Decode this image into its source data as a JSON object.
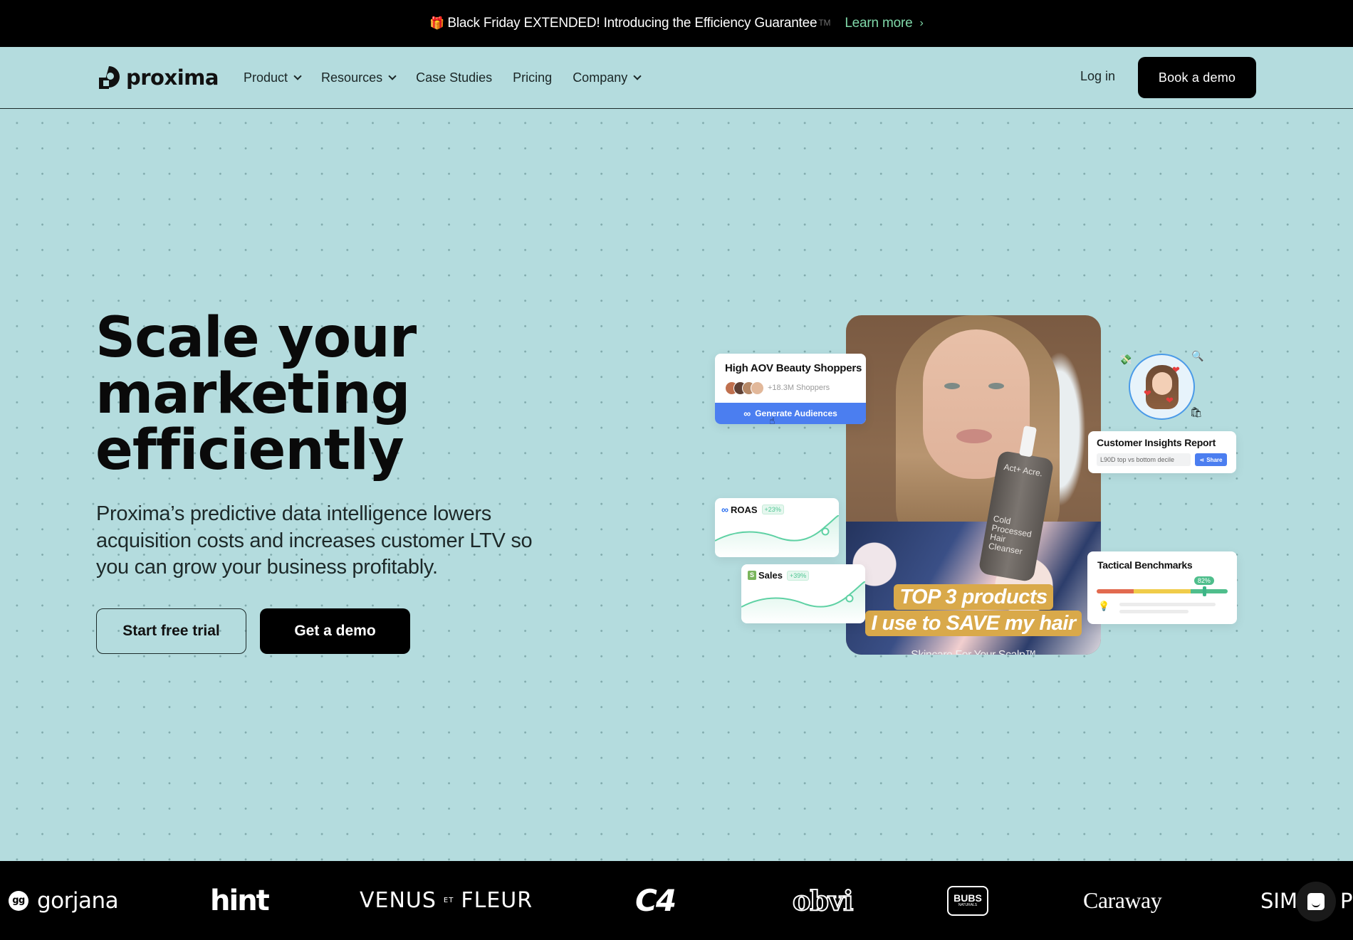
{
  "announcement": {
    "icon": "gift-icon",
    "text": "Black Friday EXTENDED! Introducing the Efficiency Guarantee",
    "trademark": "TM",
    "link_label": "Learn more",
    "link_icon": "chevron-right-icon",
    "link_color": "#7fd7a8"
  },
  "nav": {
    "brand": "proxima",
    "items": [
      {
        "label": "Product",
        "has_dropdown": true
      },
      {
        "label": "Resources",
        "has_dropdown": true
      },
      {
        "label": "Case Studies",
        "has_dropdown": false
      },
      {
        "label": "Pricing",
        "has_dropdown": false
      },
      {
        "label": "Company",
        "has_dropdown": true
      }
    ],
    "login_label": "Log in",
    "cta_label": "Book a demo"
  },
  "hero": {
    "headline": [
      "Scale your",
      "marketing",
      "efficiently"
    ],
    "subtext": "Proxima’s predictive data intelligence lowers acquisition costs and increases customer LTV so you can grow your business profitably.",
    "primary_cta": "Start free trial",
    "secondary_cta": "Get a demo",
    "background_color": "#b4dcde"
  },
  "visual": {
    "video_captions": [
      "TOP 3 products",
      "I use to SAVE my hair",
      "Skincare For Your Scalp™"
    ],
    "bottle_brand": "Act+ Acre.",
    "bottle_desc": "Cold Processed Hair Cleanser",
    "audience_card": {
      "title": "High AOV Beauty Shoppers",
      "count": "+18.3M Shoppers",
      "button_label": "Generate Audiences",
      "button_icon": "meta-icon",
      "button_color": "#4b7ef0"
    },
    "roas_card": {
      "label": "ROAS",
      "delta": "+23%",
      "icon": "meta-icon"
    },
    "sales_card": {
      "label": "Sales",
      "delta": "+39%",
      "icon": "shopify-icon"
    },
    "insights_card": {
      "title": "Customer Insights Report",
      "field_value": "L90D top vs bottom decile",
      "share_label": "Share"
    },
    "benchmarks_card": {
      "title": "Tactical Benchmarks",
      "percent_label": "82%",
      "percent_value": 0.82,
      "segments": [
        {
          "color": "#e26a4f",
          "fraction": 0.28
        },
        {
          "color": "#f0cc4a",
          "fraction": 0.44
        },
        {
          "color": "#4fbe8c",
          "fraction": 0.28
        }
      ]
    }
  },
  "logos": [
    "gorjana",
    "hint",
    "VENUS",
    "ET",
    "FLEUR",
    "C4",
    "obvi",
    "BUBS",
    "NATURALS",
    "Caraway",
    "SIM",
    "P"
  ],
  "chat_widget": {
    "icon": "chat-icon"
  }
}
